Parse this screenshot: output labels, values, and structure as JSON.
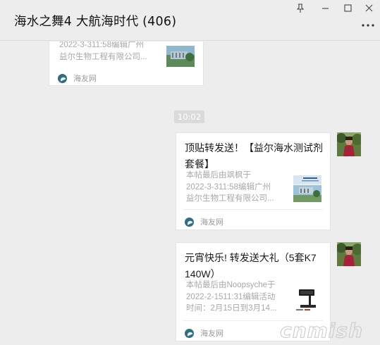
{
  "window": {
    "title": "海水之舞4 大航海时代 (406)"
  },
  "messages": [
    {
      "desc_lines": [
        "2022-3-311:58编辑广州",
        "益尔生物工程有限公司..."
      ],
      "source": "海友网"
    },
    {
      "time": "10:02"
    },
    {
      "title": "顶贴转发送！【益尔海水测试剂套餐】",
      "desc_lines": [
        "本帖最后由飒枫于",
        "2022-3-311:58编辑广州",
        "益尔生物工程有限公司..."
      ],
      "source": "海友网"
    },
    {
      "title": "元宵快乐! 转发送大礼（5套K7 140W）",
      "desc_lines": [
        "本帖最后由Noopsyche于",
        "2022-2-1511:31编辑活动",
        "时间：2月15日到3月14..."
      ],
      "source": "海友网"
    }
  ],
  "watermark": "cnmish"
}
